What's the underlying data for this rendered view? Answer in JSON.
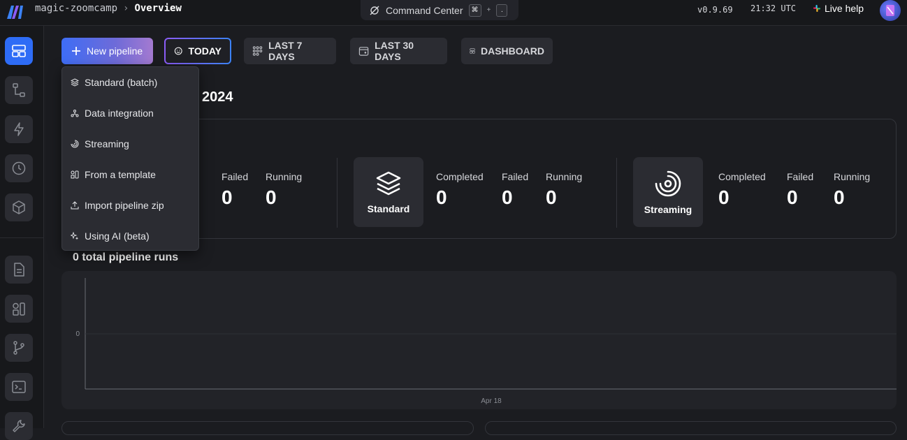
{
  "topbar": {
    "project": "magic-zoomcamp",
    "page": "Overview",
    "command_center": "Command Center",
    "shortcut_key1": "⌘",
    "shortcut_plus": "+",
    "shortcut_key2": ".",
    "version": "v0.9.69",
    "time": "21:32 UTC",
    "help": "Live help"
  },
  "toolbar": {
    "new_pipeline": "New pipeline",
    "today": "TODAY",
    "last7": "LAST 7 DAYS",
    "last30": "LAST 30 DAYS",
    "dashboard": "DASHBOARD"
  },
  "dropdown": {
    "items": [
      {
        "label": "Standard (batch)",
        "icon": "layers-icon"
      },
      {
        "label": "Data integration",
        "icon": "integration-icon"
      },
      {
        "label": "Streaming",
        "icon": "streaming-icon"
      },
      {
        "label": "From a template",
        "icon": "template-icon"
      },
      {
        "label": "Import pipeline zip",
        "icon": "upload-icon"
      },
      {
        "label": "Using AI (beta)",
        "icon": "sparkle-icon"
      }
    ]
  },
  "main": {
    "title_visible": "2024",
    "runs_title": "0 total pipeline runs"
  },
  "stats": {
    "group1": {
      "completed_label_partial": "d",
      "failed_label": "Failed",
      "failed_value": "0",
      "running_label": "Running",
      "running_value": "0"
    },
    "group2": {
      "tile": "Standard",
      "completed_label": "Completed",
      "completed_value": "0",
      "failed_label": "Failed",
      "failed_value": "0",
      "running_label": "Running",
      "running_value": "0"
    },
    "group3": {
      "tile": "Streaming",
      "completed_label": "Completed",
      "completed_value": "0",
      "failed_label": "Failed",
      "failed_value": "0",
      "running_label": "Running",
      "running_value": "0"
    }
  },
  "chart_data": {
    "type": "bar",
    "categories": [
      "Apr 18"
    ],
    "values": [
      0
    ],
    "y_tick": "0",
    "grid": true
  }
}
